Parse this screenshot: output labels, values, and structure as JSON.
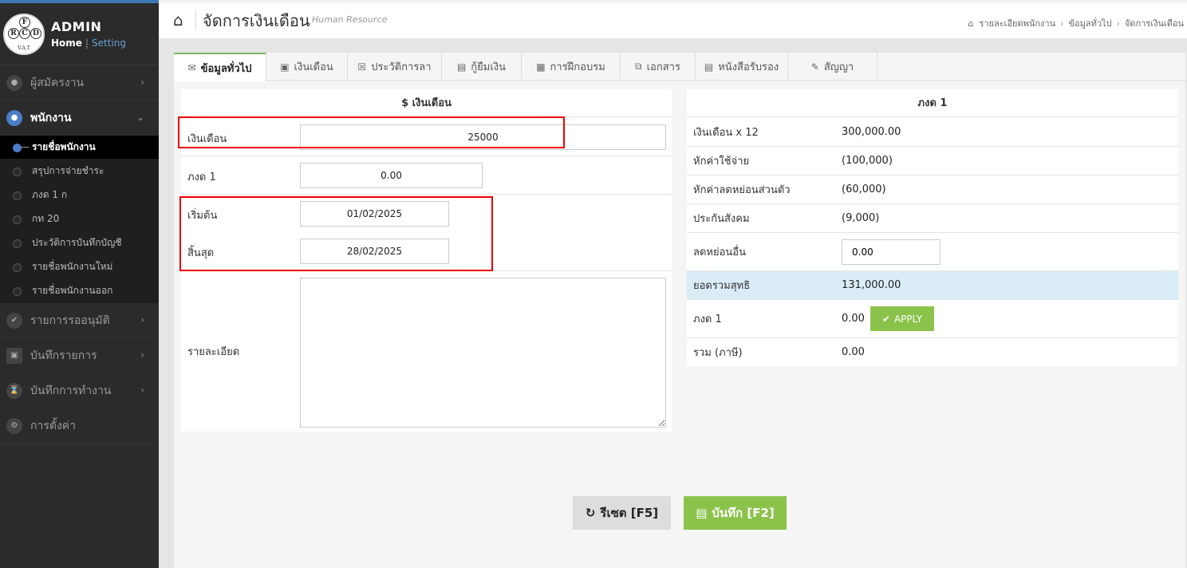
{
  "brand": {
    "logo_letters": {
      "f": "F",
      "r": "R",
      "c": "C",
      "d": "D"
    },
    "logo_caption": "V.A.T",
    "title": "ADMIN",
    "home": "Home",
    "separator": "|",
    "setting": "Setting"
  },
  "sidebar": {
    "items": [
      {
        "label": "ผู้สมัครงาน",
        "icon": "user-icon"
      },
      {
        "label": "พนักงาน",
        "icon": "user-icon"
      },
      {
        "label": "รายการรออนุมัติ",
        "icon": "check-icon"
      },
      {
        "label": "บันทึกรายการ",
        "icon": "document-icon"
      },
      {
        "label": "บันทึกการทำงาน",
        "icon": "hourglass-icon"
      },
      {
        "label": "การตั้งค่า",
        "icon": "gears-icon"
      }
    ],
    "sub_items": [
      "รายชื่อพนักงาน",
      "สรุปการจ่ายชำระ",
      "ภงด 1 ก",
      "กท 20",
      "ประวัติการบันทึกบัญชี",
      "รายชื่อพนักงานใหม่",
      "รายชื่อพนักงานออก"
    ]
  },
  "header": {
    "title": "จัดการเงินเดือน",
    "subtitle": "Human Resource",
    "breadcrumb": [
      "รายละเอียดพนักงาน",
      "ข้อมูลทั่วไป",
      "จัดการเงินเดือน"
    ],
    "breadcrumb_sep": "›"
  },
  "tabs": [
    {
      "label": "ข้อมูลทั่วไป",
      "icon": "envelope-icon"
    },
    {
      "label": "เงินเดือน",
      "icon": "money-icon"
    },
    {
      "label": "ประวัติการลา",
      "icon": "calendar-x-icon"
    },
    {
      "label": "กู้ยืมเงิน",
      "icon": "credit-card-icon"
    },
    {
      "label": "การฝึกอบรม",
      "icon": "calendar-icon"
    },
    {
      "label": "เอกสาร",
      "icon": "copy-icon"
    },
    {
      "label": "หนังสือรับรอง",
      "icon": "file-icon"
    },
    {
      "label": "สัญญา",
      "icon": "edit-icon"
    }
  ],
  "salary_form": {
    "heading": "$ เงินเดือน",
    "salary_label": "เงินเดือน",
    "salary_value": "25000",
    "pnd1_label": "ภงด 1",
    "pnd1_value": "0.00",
    "start_label": "เริ่มต้น",
    "start_value": "01/02/2025",
    "end_label": "สิ้นสุด",
    "end_value": "28/02/2025",
    "detail_label": "รายละเอียด",
    "detail_value": ""
  },
  "summary": {
    "heading": "ภงด 1",
    "rows": [
      {
        "label": "เงินเดือน x 12",
        "value": "300,000.00"
      },
      {
        "label": "หักค่าใช้จ่าย",
        "value": "(100,000)"
      },
      {
        "label": "หักค่าลดหย่อนส่วนตัว",
        "value": "(60,000)"
      },
      {
        "label": "ประกันสังคม",
        "value": "(9,000)"
      }
    ],
    "other_deduction_label": "ลดหย่อนอื่น",
    "other_deduction_value": "0.00",
    "net_label": "ยอดรวมสุทธิ",
    "net_value": "131,000.00",
    "pnd1_label": "ภงด 1",
    "pnd1_value": "0.00",
    "apply_label": "APPLY",
    "total_label": "รวม (ภาษี)",
    "total_value": "0.00"
  },
  "actions": {
    "reset_label": "รีเซต [F5]",
    "save_label": "บันทึก [F2]"
  },
  "colors": {
    "accent_green": "#8bc34a",
    "sidebar_bg": "#2b2b2b",
    "highlight_blue": "#d9ecf7",
    "annotation_red": "#e00000"
  }
}
